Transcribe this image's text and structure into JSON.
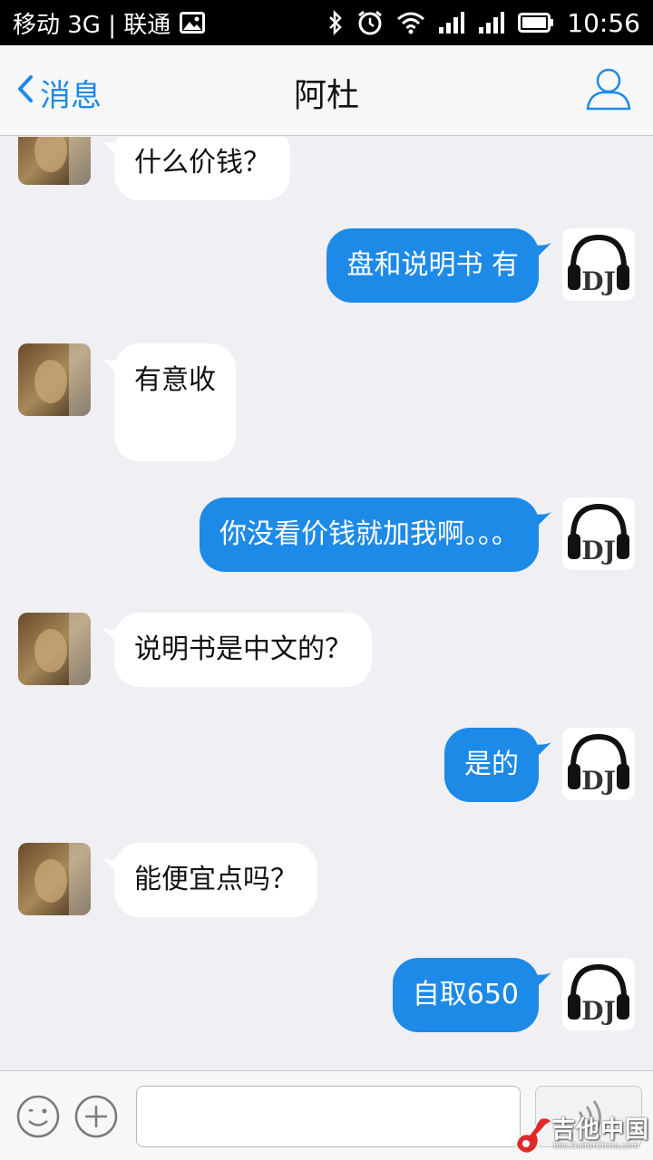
{
  "status_bar": {
    "carrier": "移动 3G | 联通",
    "time": "10:56",
    "icons": [
      "image-icon",
      "bluetooth-icon",
      "alarm-icon",
      "wifi-icon",
      "signal-icon",
      "signal-icon",
      "battery-icon"
    ]
  },
  "nav": {
    "back_label": "消息",
    "title": "阿杜"
  },
  "messages": [
    {
      "side": "in",
      "text": "什么价钱？"
    },
    {
      "side": "out",
      "text": "盘和说明书 有"
    },
    {
      "side": "in",
      "text": "有意收"
    },
    {
      "side": "out",
      "text": "你没看价钱就加我啊。。。"
    },
    {
      "side": "in",
      "text": "说明书是中文的？"
    },
    {
      "side": "out",
      "text": "是的"
    },
    {
      "side": "in",
      "text": "能便宜点吗？"
    },
    {
      "side": "out",
      "text": "自取650"
    }
  ],
  "input": {
    "value": "",
    "placeholder": ""
  },
  "watermark": {
    "text": "吉他中国",
    "sub": "bbs.GuitarChina.com"
  },
  "colors": {
    "accent": "#1e8ae8",
    "background": "#efeff4",
    "incoming_bubble": "#ffffff",
    "outgoing_bubble": "#1e8ae8"
  }
}
